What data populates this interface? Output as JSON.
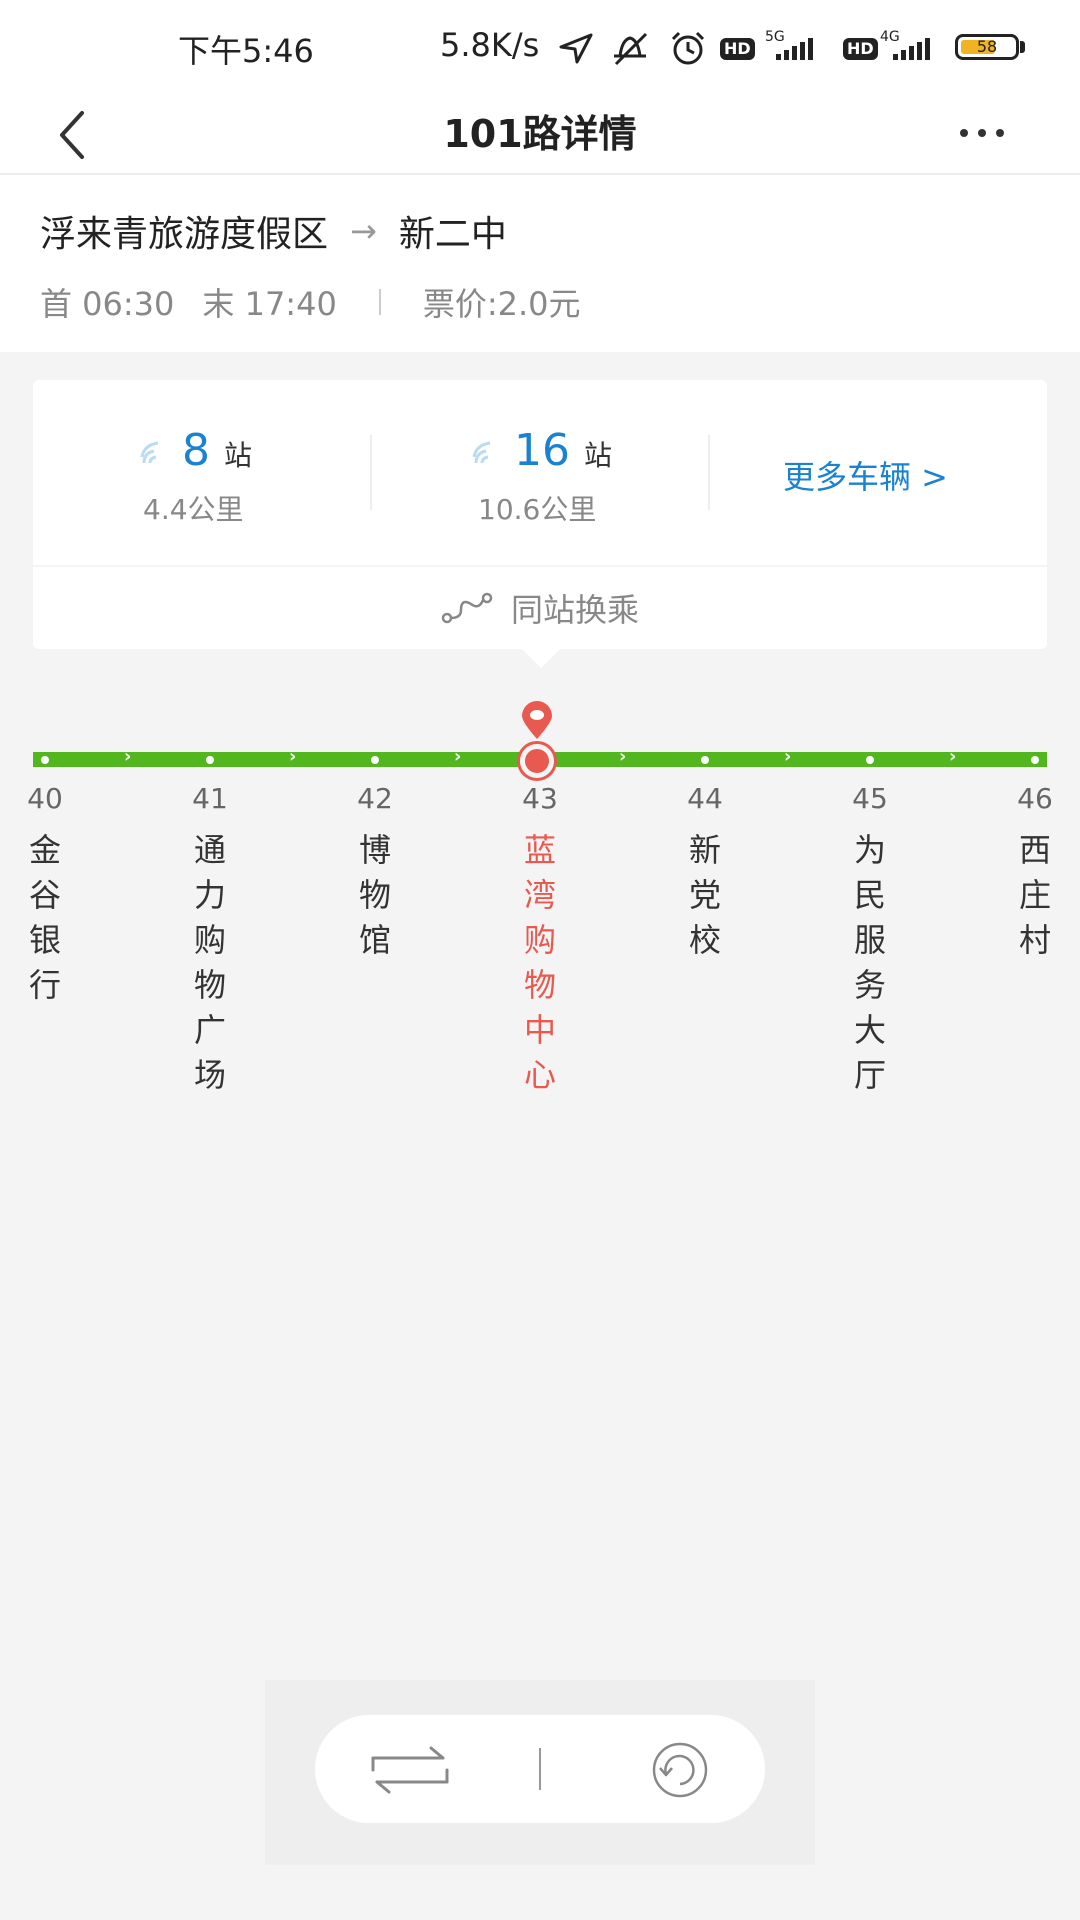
{
  "status_bar": {
    "time": "下午5:46",
    "speed": "5.8K/s",
    "hd1": "HD",
    "net1": "5G",
    "hd2": "HD",
    "net2": "4G",
    "battery": "58",
    "icons": [
      "location-arrow-icon",
      "mute-icon",
      "alarm-icon",
      "signal-icon",
      "battery-icon"
    ]
  },
  "nav": {
    "title": "101路详情",
    "back_icon": "chevron-left-icon",
    "more_icon": "more-dots-icon"
  },
  "route": {
    "from": "浮来青旅游度假区",
    "arrow": "→",
    "to": "新二中",
    "first_bus": "首 06:30",
    "last_bus": "末 17:40",
    "fare": "票价:2.0元"
  },
  "buses": [
    {
      "stops": "8",
      "unit": "站",
      "distance": "4.4公里"
    },
    {
      "stops": "16",
      "unit": "站",
      "distance": "10.6公里"
    }
  ],
  "more_buses_label": "更多车辆 >",
  "transfer_label": "同站换乘",
  "stations": [
    {
      "num": "40",
      "name": "金谷银行",
      "current": false
    },
    {
      "num": "41",
      "name": "通力购物广场",
      "current": false
    },
    {
      "num": "42",
      "name": "博物馆",
      "current": false
    },
    {
      "num": "43",
      "name": "蓝湾购物中心",
      "current": true
    },
    {
      "num": "44",
      "name": "新党校",
      "current": false
    },
    {
      "num": "45",
      "name": "为民服务大厅",
      "current": false
    },
    {
      "num": "46",
      "name": "西庄村",
      "current": false
    }
  ],
  "colors": {
    "accent_blue": "#1b82d1",
    "line_green": "#52b71f",
    "current_red": "#e85a4f"
  }
}
